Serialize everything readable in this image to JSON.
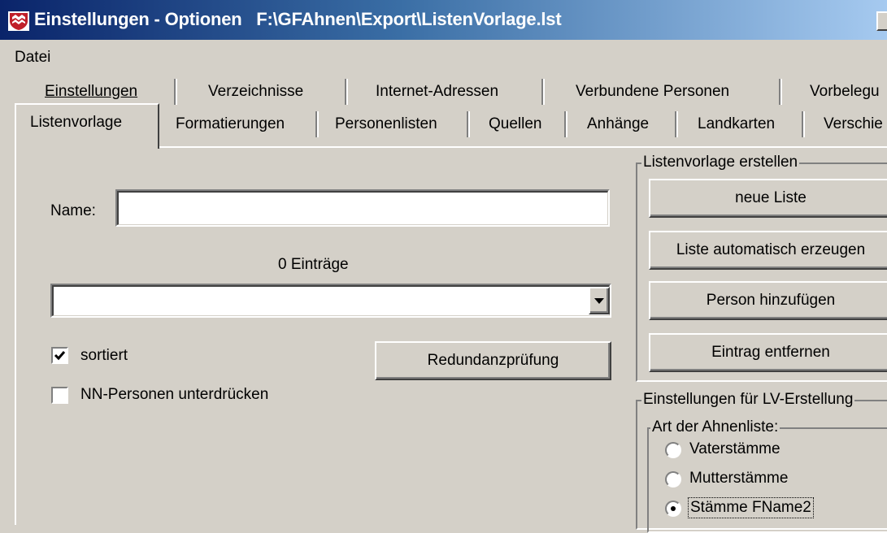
{
  "window": {
    "title": "Einstellungen - Optionen   F:\\GFAhnen\\Export\\ListenVorlage.lst",
    "icon": "app-shield-icon"
  },
  "menu": {
    "items": [
      "Datei"
    ]
  },
  "tabs": {
    "row_top": [
      "Einstellungen",
      "Verzeichnisse",
      "Internet-Adressen",
      "Verbundene Personen",
      "Vorbelegu"
    ],
    "row_bottom": [
      "Listenvorlage",
      "Formatierungen",
      "Personenlisten",
      "Quellen",
      "Anhänge",
      "Landkarten",
      "Verschie"
    ],
    "active": "Listenvorlage"
  },
  "form": {
    "name_label": "Name:",
    "name_value": "",
    "entries_count": "0 Einträge",
    "entries_selected": "",
    "checkbox_sorted_label": "sortiert",
    "checkbox_sorted_checked": true,
    "checkbox_nn_label": "NN-Personen unterdrücken",
    "checkbox_nn_checked": false,
    "redundancy_button": "Redundanzprüfung"
  },
  "create_group": {
    "title": "Listenvorlage erstellen",
    "buttons": [
      "neue Liste",
      "Liste automatisch erzeugen",
      "Person hinzufügen",
      "Eintrag entfernen"
    ]
  },
  "settings_group": {
    "title": "Einstellungen für LV-Erstellung",
    "subgroup_title": "Art der Ahnenliste:",
    "options": [
      "Vaterstämme",
      "Mutterstämme",
      "Stämme FName2"
    ],
    "selected_index": 2
  },
  "colors": {
    "face": "#d4d0c8",
    "title_start": "#0a246a",
    "title_end": "#a6caf0"
  }
}
